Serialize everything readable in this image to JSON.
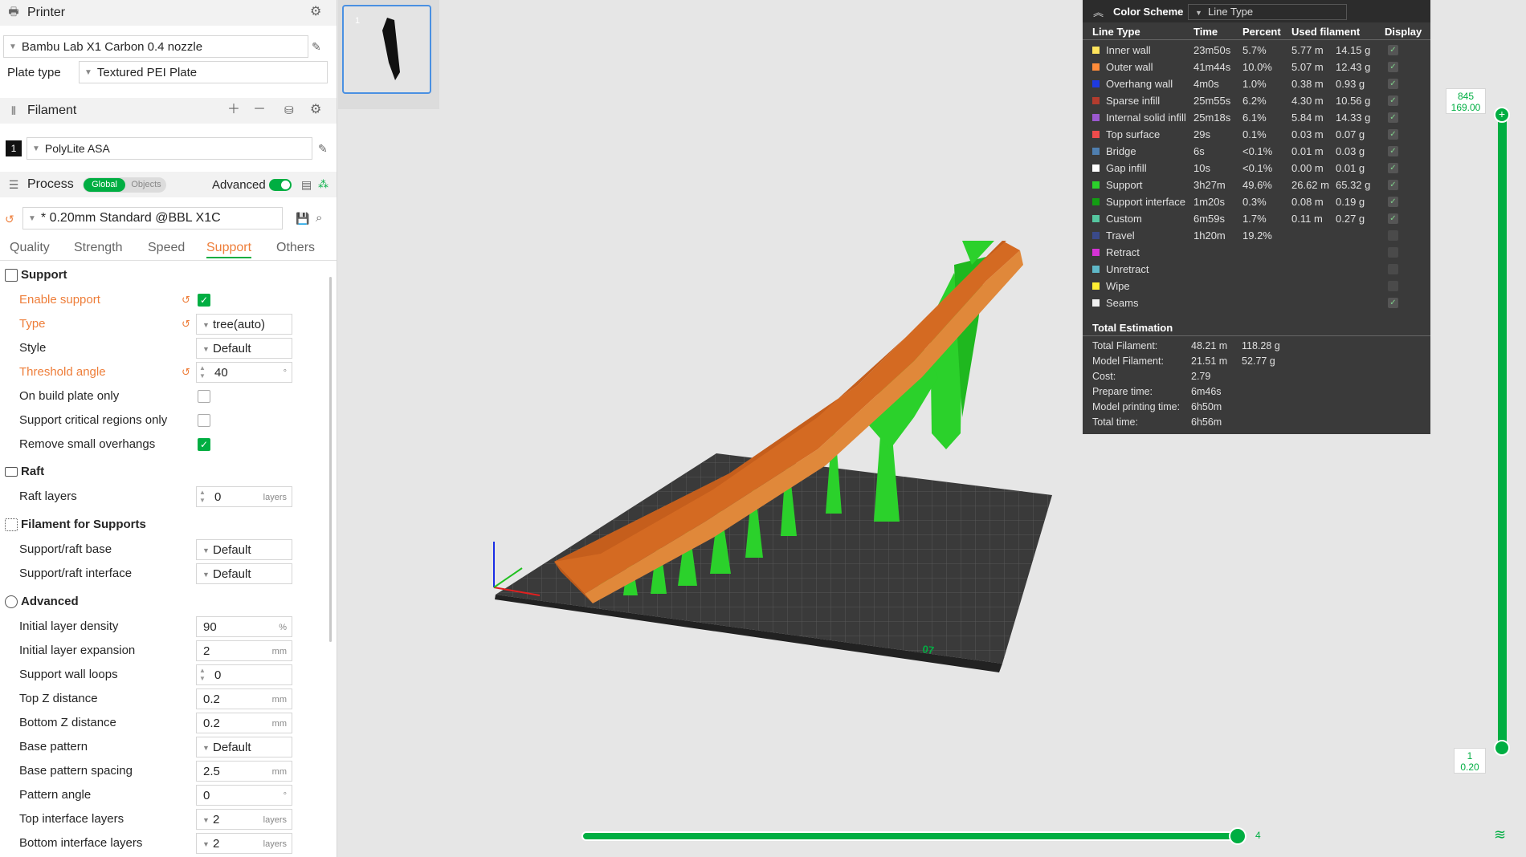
{
  "printer": {
    "header": "Printer",
    "machine": "Bambu Lab X1 Carbon 0.4 nozzle",
    "plate_type_label": "Plate type",
    "plate_type": "Textured PEI Plate"
  },
  "filament": {
    "header": "Filament",
    "slot": "1",
    "name": "PolyLite ASA"
  },
  "process": {
    "header": "Process",
    "toggle_global": "Global",
    "toggle_objects": "Objects",
    "advanced_label": "Advanced",
    "preset": "* 0.20mm Standard @BBL X1C"
  },
  "tabs": [
    "Quality",
    "Strength",
    "Speed",
    "Support",
    "Others"
  ],
  "groups": {
    "support": "Support",
    "raft": "Raft",
    "filament_for_supports": "Filament for Supports",
    "advanced": "Advanced"
  },
  "settings": {
    "enable_support": "Enable support",
    "type_label": "Type",
    "type_value": "tree(auto)",
    "style_label": "Style",
    "style_value": "Default",
    "threshold_label": "Threshold angle",
    "threshold_value": "40",
    "threshold_unit": "°",
    "on_build_plate": "On build plate only",
    "critical_regions": "Support critical regions only",
    "remove_small": "Remove small overhangs",
    "raft_layers_label": "Raft layers",
    "raft_layers_value": "0",
    "raft_layers_unit": "layers",
    "raft_base_label": "Support/raft base",
    "raft_base_value": "Default",
    "raft_interface_label": "Support/raft interface",
    "raft_interface_value": "Default",
    "init_density_label": "Initial layer density",
    "init_density_value": "90",
    "init_density_unit": "%",
    "init_expansion_label": "Initial layer expansion",
    "init_expansion_value": "2",
    "init_expansion_unit": "mm",
    "wall_loops_label": "Support wall loops",
    "wall_loops_value": "0",
    "top_z_label": "Top Z distance",
    "top_z_value": "0.2",
    "top_z_unit": "mm",
    "bottom_z_label": "Bottom Z distance",
    "bottom_z_value": "0.2",
    "bottom_z_unit": "mm",
    "base_pattern_label": "Base pattern",
    "base_pattern_value": "Default",
    "base_spacing_label": "Base pattern spacing",
    "base_spacing_value": "2.5",
    "base_spacing_unit": "mm",
    "pattern_angle_label": "Pattern angle",
    "pattern_angle_value": "0",
    "pattern_angle_unit": "°",
    "top_iface_label": "Top interface layers",
    "top_iface_value": "2",
    "top_iface_unit": "layers",
    "bottom_iface_label": "Bottom interface layers",
    "bottom_iface_value": "2",
    "bottom_iface_unit": "layers"
  },
  "plate_thumb": "1",
  "color_scheme": {
    "title": "Color Scheme",
    "mode": "Line Type",
    "headers": [
      "Line Type",
      "Time",
      "Percent",
      "Used filament",
      "Display"
    ],
    "rows": [
      {
        "name": "Inner wall",
        "time": "23m50s",
        "pct": "5.7%",
        "len": "5.77 m",
        "wt": "14.15 g",
        "color": "#ffe45c",
        "on": true
      },
      {
        "name": "Outer wall",
        "time": "41m44s",
        "pct": "10.0%",
        "len": "5.07 m",
        "wt": "12.43 g",
        "color": "#ff8c3a",
        "on": true
      },
      {
        "name": "Overhang wall",
        "time": "4m0s",
        "pct": "1.0%",
        "len": "0.38 m",
        "wt": "0.93 g",
        "color": "#1e3ae0",
        "on": true
      },
      {
        "name": "Sparse infill",
        "time": "25m55s",
        "pct": "6.2%",
        "len": "4.30 m",
        "wt": "10.56 g",
        "color": "#b33c2e",
        "on": true
      },
      {
        "name": "Internal solid infill",
        "time": "25m18s",
        "pct": "6.1%",
        "len": "5.84 m",
        "wt": "14.33 g",
        "color": "#9b59d0",
        "on": true
      },
      {
        "name": "Top surface",
        "time": "29s",
        "pct": "0.1%",
        "len": "0.03 m",
        "wt": "0.07 g",
        "color": "#ee4c4c",
        "on": true
      },
      {
        "name": "Bridge",
        "time": "6s",
        "pct": "<0.1%",
        "len": "0.01 m",
        "wt": "0.03 g",
        "color": "#4f7fb0",
        "on": true
      },
      {
        "name": "Gap infill",
        "time": "10s",
        "pct": "<0.1%",
        "len": "0.00 m",
        "wt": "0.01 g",
        "color": "#ffffff",
        "on": true
      },
      {
        "name": "Support",
        "time": "3h27m",
        "pct": "49.6%",
        "len": "26.62 m",
        "wt": "65.32 g",
        "color": "#2bd12b",
        "on": true
      },
      {
        "name": "Support interface",
        "time": "1m20s",
        "pct": "0.3%",
        "len": "0.08 m",
        "wt": "0.19 g",
        "color": "#139e13",
        "on": true
      },
      {
        "name": "Custom",
        "time": "6m59s",
        "pct": "1.7%",
        "len": "0.11 m",
        "wt": "0.27 g",
        "color": "#55c7a0",
        "on": true
      },
      {
        "name": "Travel",
        "time": "1h20m",
        "pct": "19.2%",
        "len": "",
        "wt": "",
        "color": "#3a4a8a",
        "on": false
      },
      {
        "name": "Retract",
        "time": "",
        "pct": "",
        "len": "",
        "wt": "",
        "color": "#d633d6",
        "on": false
      },
      {
        "name": "Unretract",
        "time": "",
        "pct": "",
        "len": "",
        "wt": "",
        "color": "#5fb8c8",
        "on": false
      },
      {
        "name": "Wipe",
        "time": "",
        "pct": "",
        "len": "",
        "wt": "",
        "color": "#ffee33",
        "on": false
      },
      {
        "name": "Seams",
        "time": "",
        "pct": "",
        "len": "",
        "wt": "",
        "color": "#f0f0f0",
        "on": true
      }
    ]
  },
  "total_estimation": {
    "title": "Total Estimation",
    "rows": [
      {
        "label": "Total Filament:",
        "v1": "48.21 m",
        "v2": "118.28 g"
      },
      {
        "label": "Model Filament:",
        "v1": "21.51 m",
        "v2": "52.77 g"
      },
      {
        "label": "Cost:",
        "v1": "2.79",
        "v2": ""
      },
      {
        "label": "Prepare time:",
        "v1": "6m46s",
        "v2": ""
      },
      {
        "label": "Model printing time:",
        "v1": "6h50m",
        "v2": ""
      },
      {
        "label": "Total time:",
        "v1": "6h56m",
        "v2": ""
      }
    ]
  },
  "layer_slider": {
    "top_layer": "845",
    "top_height": "169.00",
    "bottom_layer": "1",
    "bottom_height": "0.20"
  },
  "move_slider": {
    "value": "4"
  },
  "plate_label": "07",
  "colors": {
    "accent": "#00ae42",
    "modified": "#ee7e3a",
    "panel_bg": "#3a3a3a"
  }
}
